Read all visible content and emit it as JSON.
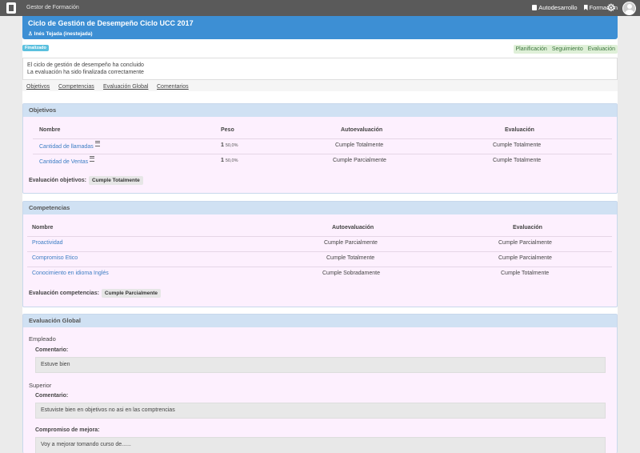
{
  "app": {
    "title": "Gestor de Formación"
  },
  "topnav": {
    "autodesarrollo": "Autodesarrollo",
    "formacion": "Formación"
  },
  "header": {
    "title_prefix": "Ciclo de Gestión de Desempeño",
    "title_cycle": "Ciclo UCC 2017",
    "user": "Inés Tejada (inestejada)"
  },
  "status_badge": "Finalizado",
  "steps": [
    "Planificación",
    "Seguimiento",
    "Evaluación"
  ],
  "message": {
    "line1": "El ciclo de gestión de desempeño ha concluido",
    "line2": "La evaluación ha sido finalizada correctamente"
  },
  "tabs": [
    "Objetivos",
    "Competencias",
    "Evaluación Global",
    "Comentarios"
  ],
  "objetivos": {
    "title": "Objetivos",
    "headers": {
      "nombre": "Nombre",
      "peso": "Peso",
      "auto": "Autoevaluación",
      "eval": "Evaluación"
    },
    "rows": [
      {
        "nombre": "Cantidad de llamadas",
        "peso": "1",
        "pct": "50,0%",
        "auto": "Cumple Totalmente",
        "eval": "Cumple Totalmente"
      },
      {
        "nombre": "Cantidad de Ventas",
        "peso": "1",
        "pct": "50,0%",
        "auto": "Cumple Parcialmente",
        "eval": "Cumple Totalmente"
      }
    ],
    "summary_label": "Evaluación objetivos:",
    "summary_value": "Cumple Totalmente"
  },
  "competencias": {
    "title": "Competencias",
    "headers": {
      "nombre": "Nombre",
      "auto": "Autoevaluación",
      "eval": "Evaluación"
    },
    "rows": [
      {
        "nombre": "Proactividad",
        "auto": "Cumple Parcialmente",
        "eval": "Cumple Parcialmente"
      },
      {
        "nombre": "Compromiso Etico",
        "auto": "Cumple Totalmente",
        "eval": "Cumple Parcialmente"
      },
      {
        "nombre": "Conocimiento en idioma Inglés",
        "auto": "Cumple Sobradamente",
        "eval": "Cumple Totalmente"
      }
    ],
    "summary_label": "Evaluación competencias:",
    "summary_value": "Cumple Parcialmente"
  },
  "global": {
    "title": "Evaluación Global",
    "empleado": {
      "label": "Empleado",
      "comentario_label": "Comentario:",
      "comentario": "Estuve bien"
    },
    "superior": {
      "label": "Superior",
      "comentario_label": "Comentario:",
      "comentario": "Estuviste bien en objetivos no asi en las comptrencias",
      "compromiso_label": "Compromiso de mejora:",
      "compromiso": "Voy a mejorar tomando curso de......"
    }
  }
}
